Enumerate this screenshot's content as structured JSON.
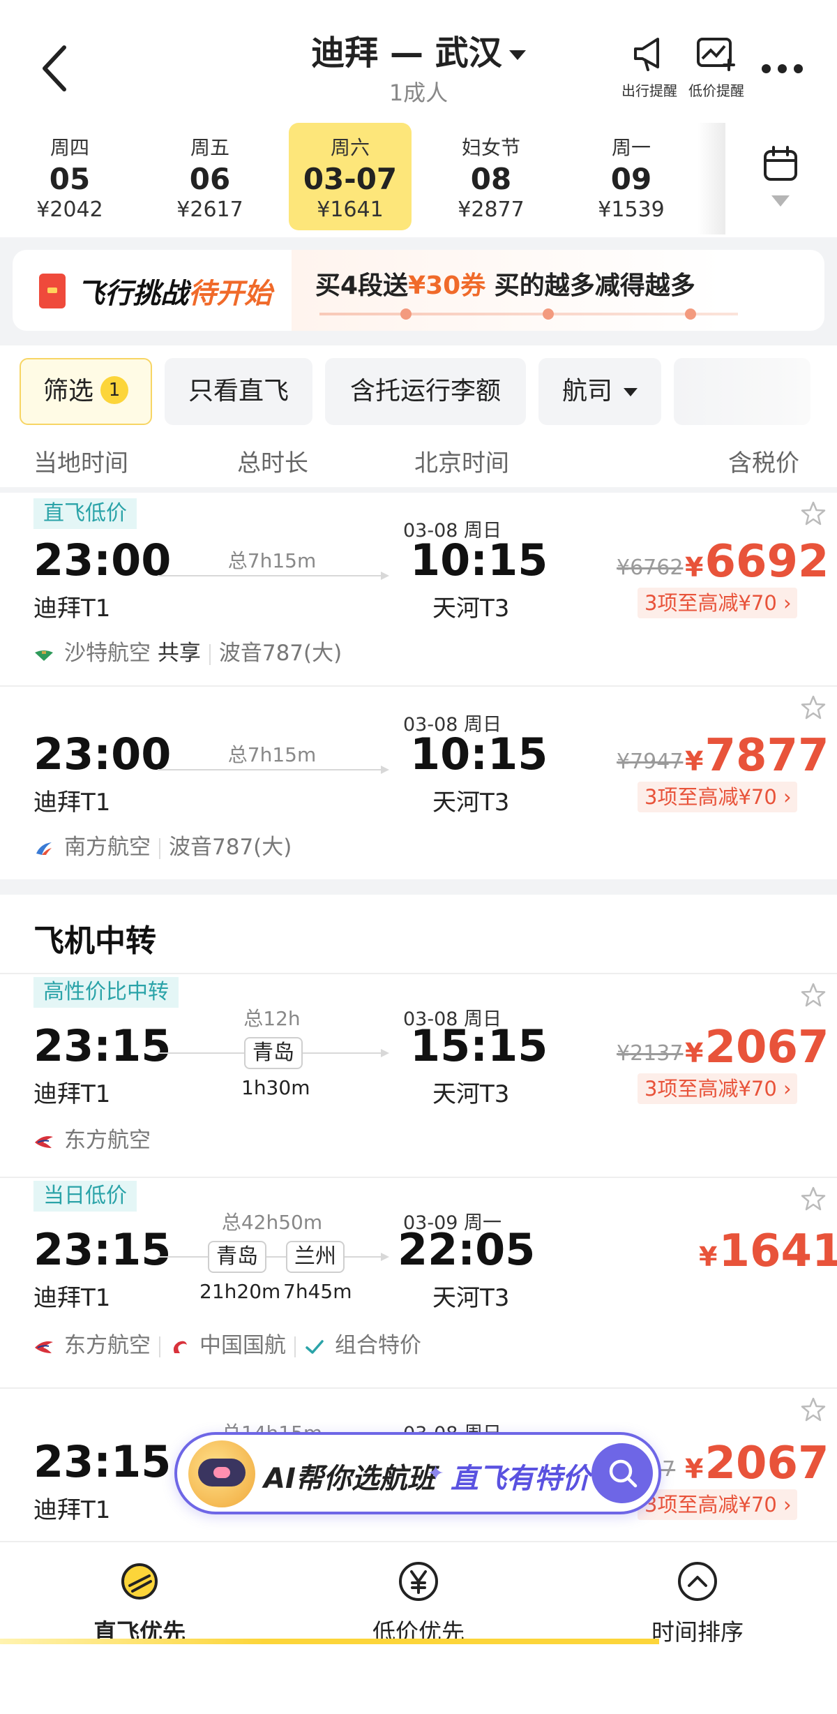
{
  "header": {
    "title": "迪拜 — 武汉",
    "subtitle": "1成人",
    "alert_trip_label": "出行提醒",
    "alert_price_label": "低价提醒"
  },
  "dates": [
    {
      "weekday": "周四",
      "day": "05",
      "price": "¥2042",
      "selected": false
    },
    {
      "weekday": "周五",
      "day": "06",
      "price": "¥2617",
      "selected": false
    },
    {
      "weekday": "周六",
      "day": "03-07",
      "price": "¥1641",
      "selected": true
    },
    {
      "weekday": "妇女节",
      "day": "08",
      "price": "¥2877",
      "selected": false
    },
    {
      "weekday": "周一",
      "day": "09",
      "price": "¥1539",
      "selected": false
    }
  ],
  "promo": {
    "title_a": "飞行挑战",
    "title_b": "待开始",
    "text_a": "买4段送",
    "text_b": "¥30券",
    "text_c": " 买的越多减得越多"
  },
  "filters": {
    "filter_label": "筛选",
    "filter_count": "1",
    "direct_only": "只看直飞",
    "with_baggage": "含托运行李额",
    "airline": "航司"
  },
  "columns": {
    "local_time": "当地时间",
    "duration": "总时长",
    "beijing_time": "北京时间",
    "price_incl_tax": "含税价"
  },
  "flights_direct": [
    {
      "tag": "直飞低价",
      "depart_time": "23:00",
      "depart_terminal": "迪拜T1",
      "duration": "总7h15m",
      "arrive_date": "03-08 周日",
      "arrive_time": "10:15",
      "arrive_terminal": "天河T3",
      "old_price": "¥6762",
      "price": "6692",
      "promo": "3项至高减¥70",
      "airline": "沙特航空",
      "share": "共享",
      "aircraft": "波音787(大)"
    },
    {
      "tag": "",
      "depart_time": "23:00",
      "depart_terminal": "迪拜T1",
      "duration": "总7h15m",
      "arrive_date": "03-08 周日",
      "arrive_time": "10:15",
      "arrive_terminal": "天河T3",
      "old_price": "¥7947",
      "price": "7877",
      "promo": "3项至高减¥70",
      "airline": "南方航空",
      "aircraft": "波音787(大)"
    }
  ],
  "transfer_section_title": "飞机中转",
  "flights_transfer": [
    {
      "tag": "高性价比中转",
      "depart_time": "23:15",
      "depart_terminal": "迪拜T1",
      "duration": "总12h",
      "stop1": "青岛",
      "stop1_time": "1h30m",
      "arrive_date": "03-08 周日",
      "arrive_time": "15:15",
      "arrive_terminal": "天河T3",
      "old_price": "¥2137",
      "price": "2067",
      "promo": "3项至高减¥70",
      "airline": "东方航空"
    },
    {
      "tag": "当日低价",
      "depart_time": "23:15",
      "depart_terminal": "迪拜T1",
      "duration": "总42h50m",
      "stop1": "青岛",
      "stop1_time": "21h20m",
      "stop2": "兰州",
      "stop2_time": "7h45m",
      "arrive_date": "03-09 周一",
      "arrive_time": "22:05",
      "arrive_terminal": "天河T3",
      "price": "1641",
      "airline": "东方航空",
      "airline2": "中国国航",
      "combo": "组合特价"
    },
    {
      "depart_time": "23:15",
      "depart_terminal": "迪拜T1",
      "duration": "总14h15m",
      "arrive_date": "03-08 周日",
      "old_price": "37",
      "price": "2067",
      "promo": "3项至高减¥70"
    }
  ],
  "ai_assistant": {
    "text": "AI帮你选航班",
    "sparkle": "✦",
    "highlight": "直飞有特价"
  },
  "bottom_tabs": [
    {
      "label": "直飞优先",
      "icon": "plane-badge-icon",
      "active": true
    },
    {
      "label": "低价优先",
      "icon": "yen-icon",
      "active": false
    },
    {
      "label": "时间排序",
      "icon": "chevron-up-icon",
      "active": false
    }
  ],
  "yen_symbol": "¥",
  "colors": {
    "accent": "#fcd53a",
    "price": "#e8533a",
    "tag": "#2aa3a8",
    "ai": "#6e66e6"
  }
}
